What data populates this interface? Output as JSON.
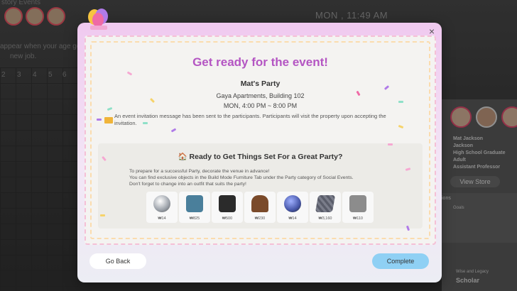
{
  "background": {
    "clock": "MON , 11:49 AM",
    "left_text_1": "appear when your age ge",
    "left_text_2": "new job.",
    "top_left_text": "story Events",
    "grid_numbers": [
      "2",
      "3",
      "4",
      "5",
      "6"
    ],
    "profile": {
      "name_1": "Mat Jackson",
      "name_2": "Jackson",
      "education": "High School Graduate",
      "life_stage": "Adult",
      "career": "Assistant Professor",
      "view_store": "View Store",
      "section_1": "ions",
      "goals_label": "Goals",
      "scholar": "Scholar",
      "legacy": "Wise and Legacy"
    }
  },
  "dialog": {
    "title": "Get ready for the event!",
    "party_name": "Mat's Party",
    "location": "Gaya Apartments, Building 102",
    "time": "MON, 4:00 PM ~ 8:00 PM",
    "invitation_text": "An event invitation message has been sent to the participants. Participants will visit the property upon accepting the invitation.",
    "section_title": "Ready to Get Things Set For a Great Party?",
    "tip_1": "To prepare for a successful Party, decorate the venue in advance!",
    "tip_2": "You can find exclusive objects in the Build Mode Furniture Tab under the Party category of Social Events.",
    "tip_3": "Don't forget to change into an outfit that suits the party!",
    "items": [
      {
        "name": "disco-ball",
        "price": "14",
        "color": "#9aa0a8"
      },
      {
        "name": "drink-dispenser",
        "price": "825",
        "color": "#4a7f9b"
      },
      {
        "name": "speaker",
        "price": "500",
        "color": "#2b2b2b"
      },
      {
        "name": "jukebox",
        "price": "230",
        "color": "#7a4a2a"
      },
      {
        "name": "globe-lamp",
        "price": "14",
        "color": "#4656a8"
      },
      {
        "name": "dance-floor",
        "price": "3,160",
        "color": "#5a5d6a"
      },
      {
        "name": "dj-deck",
        "price": "110",
        "color": "#8c8c8c"
      }
    ],
    "currency_symbol": "₩",
    "go_back_label": "Go Back",
    "complete_label": "Complete",
    "close_glyph": "×"
  }
}
